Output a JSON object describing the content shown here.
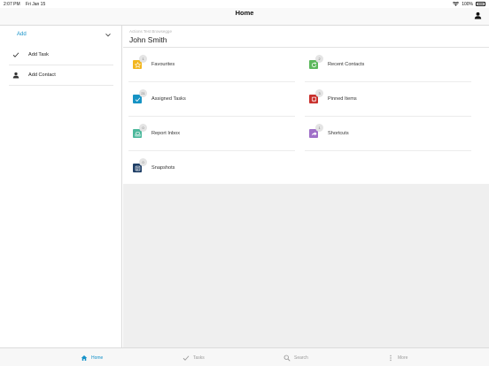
{
  "status_bar": {
    "time": "2:07 PM",
    "date": "Fri Jan 15",
    "battery": "100%"
  },
  "nav": {
    "title": "Home"
  },
  "sidebar": {
    "add_label": "Add",
    "items": [
      {
        "label": "Add Task",
        "icon": "checkmark-icon"
      },
      {
        "label": "Add Contact",
        "icon": "person-icon"
      }
    ]
  },
  "header": {
    "breadcrumb": "Actions Test Browsegge",
    "name": "John Smith"
  },
  "tiles": [
    {
      "label": "Favourites",
      "badge": "1",
      "icon": "star-icon",
      "color": "#f2b61f"
    },
    {
      "label": "Recent Contacts",
      "badge": "2",
      "icon": "refresh-icon",
      "color": "#5cb85c"
    },
    {
      "label": "Assigned Tasks",
      "badge": "21",
      "icon": "checkmark-icon",
      "color": "#1693c4"
    },
    {
      "label": "Pinned Items",
      "badge": "3",
      "icon": "pin-icon",
      "color": "#c9302c"
    },
    {
      "label": "Report Inbox",
      "badge": "0",
      "icon": "inbox-icon",
      "color": "#4cb89c"
    },
    {
      "label": "Shortcuts",
      "badge": "1",
      "icon": "shortcut-icon",
      "color": "#a070c8"
    },
    {
      "label": "Snapshots",
      "badge": "0",
      "icon": "snapshot-icon",
      "color": "#1f3f66"
    }
  ],
  "tabbar": {
    "tabs": [
      {
        "label": "Home",
        "icon": "home-icon",
        "active": true
      },
      {
        "label": "Tasks",
        "icon": "checkmark-icon",
        "active": false
      },
      {
        "label": "Search",
        "icon": "search-icon",
        "active": false
      },
      {
        "label": "More",
        "icon": "more-icon",
        "active": false
      }
    ]
  }
}
